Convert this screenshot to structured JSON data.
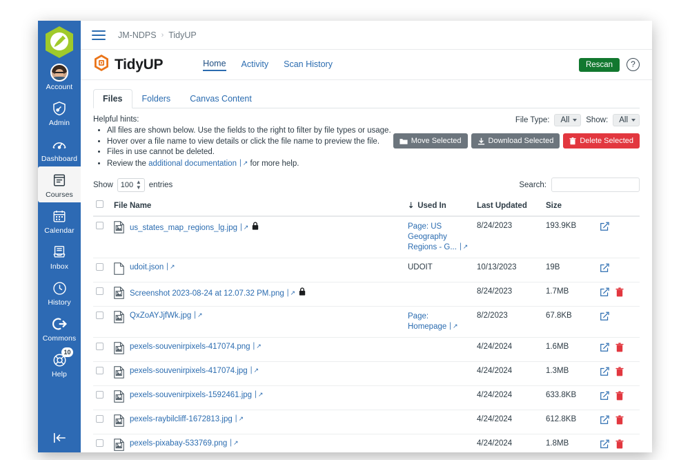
{
  "globalnav": {
    "logo_icon": "canvas-paintbrush-hex-logo",
    "items": [
      {
        "label": "Account",
        "icon": "user-avatar-icon",
        "active": false
      },
      {
        "label": "Admin",
        "icon": "shield-icon",
        "active": false
      },
      {
        "label": "Dashboard",
        "icon": "dashboard-speedometer-icon",
        "active": false
      },
      {
        "label": "Courses",
        "icon": "courses-book-icon",
        "active": true
      },
      {
        "label": "Calendar",
        "icon": "calendar-icon",
        "active": false
      },
      {
        "label": "Inbox",
        "icon": "inbox-tray-icon",
        "active": false
      },
      {
        "label": "History",
        "icon": "clock-history-icon",
        "active": false
      },
      {
        "label": "Commons",
        "icon": "commons-arrow-icon",
        "active": false
      },
      {
        "label": "Help",
        "icon": "help-lifesaver-icon",
        "badge": "10",
        "active": false
      }
    ],
    "collapse_icon": "collapse-left-icon"
  },
  "breadcrumb": {
    "menu_icon": "hamburger-menu-icon",
    "items": [
      "JM-NDPS",
      "TidyUP"
    ],
    "separator": "›"
  },
  "header": {
    "logo_icon": "tidyup-hex-logo",
    "app_name": "TidyUP",
    "nav": [
      {
        "label": "Home",
        "active": true
      },
      {
        "label": "Activity",
        "active": false
      },
      {
        "label": "Scan History",
        "active": false
      }
    ],
    "rescan_label": "Rescan",
    "rescan_color": "#12782f",
    "help_icon": "question-mark-icon",
    "help_glyph": "?"
  },
  "tabs": [
    {
      "label": "Files",
      "active": true
    },
    {
      "label": "Folders",
      "active": false
    },
    {
      "label": "Canvas Content",
      "active": false
    }
  ],
  "hints": {
    "title": "Helpful hints:",
    "items": [
      "All files are shown below. Use the fields to the right to filter by file types or usage.",
      "Hover over a file name to view details or click the file name to preview the file.",
      "Files in use cannot be deleted."
    ],
    "last_prefix": "Review the ",
    "last_link": "additional documentation",
    "last_suffix": " for more help."
  },
  "filters": {
    "file_type_label": "File Type:",
    "file_type_value": "All",
    "show_label": "Show:",
    "show_value": "All"
  },
  "actions": {
    "move_label": "Move Selected",
    "move_icon": "folder-icon",
    "download_label": "Download Selected",
    "download_icon": "download-icon",
    "delete_label": "Delete Selected",
    "delete_icon": "trash-icon",
    "delete_color": "#e2373f"
  },
  "tablebar": {
    "show_prefix": "Show",
    "entries_value": "100",
    "show_suffix": "entries",
    "search_label": "Search:",
    "search_value": "",
    "search_placeholder": ""
  },
  "table": {
    "columns": [
      "File Name",
      "Used In",
      "Last Updated",
      "Size"
    ],
    "sort_icon": "sort-descending-arrow",
    "rows": [
      {
        "file_name": "us_states_map_regions_lg.jpg",
        "file_icon": "image-file-icon",
        "locked": true,
        "used_in": "Page: US Geography Regions - G...",
        "used_in_is_link": true,
        "last_updated": "8/24/2023",
        "size": "193.9KB",
        "can_edit": true,
        "can_delete": false
      },
      {
        "file_name": "udoit.json",
        "file_icon": "document-file-icon",
        "locked": false,
        "used_in": "UDOIT",
        "used_in_is_link": false,
        "last_updated": "10/13/2023",
        "size": "19B",
        "can_edit": true,
        "can_delete": false
      },
      {
        "file_name": "Screenshot 2023-08-24 at 12.07.32 PM.png",
        "file_icon": "image-file-icon",
        "locked": true,
        "used_in": "",
        "used_in_is_link": false,
        "last_updated": "8/24/2023",
        "size": "1.7MB",
        "can_edit": true,
        "can_delete": true
      },
      {
        "file_name": "QxZoAYJjfWk.jpg",
        "file_icon": "image-file-icon",
        "locked": false,
        "used_in": "Page: Homepage",
        "used_in_is_link": true,
        "last_updated": "8/2/2023",
        "size": "67.8KB",
        "can_edit": true,
        "can_delete": false
      },
      {
        "file_name": "pexels-souvenirpixels-417074.png",
        "file_icon": "image-file-icon",
        "locked": false,
        "used_in": "",
        "used_in_is_link": false,
        "last_updated": "4/24/2024",
        "size": "1.6MB",
        "can_edit": true,
        "can_delete": true
      },
      {
        "file_name": "pexels-souvenirpixels-417074.jpg",
        "file_icon": "image-file-icon",
        "locked": false,
        "used_in": "",
        "used_in_is_link": false,
        "last_updated": "4/24/2024",
        "size": "1.3MB",
        "can_edit": true,
        "can_delete": true
      },
      {
        "file_name": "pexels-souvenirpixels-1592461.jpg",
        "file_icon": "image-file-icon",
        "locked": false,
        "used_in": "",
        "used_in_is_link": false,
        "last_updated": "4/24/2024",
        "size": "633.8KB",
        "can_edit": true,
        "can_delete": true
      },
      {
        "file_name": "pexels-raybilcliff-1672813.jpg",
        "file_icon": "image-file-icon",
        "locked": false,
        "used_in": "",
        "used_in_is_link": false,
        "last_updated": "4/24/2024",
        "size": "612.8KB",
        "can_edit": true,
        "can_delete": true
      },
      {
        "file_name": "pexels-pixabay-533769.png",
        "file_icon": "image-file-icon",
        "locked": false,
        "used_in": "",
        "used_in_is_link": false,
        "last_updated": "4/24/2024",
        "size": "1.8MB",
        "can_edit": true,
        "can_delete": true
      }
    ]
  }
}
